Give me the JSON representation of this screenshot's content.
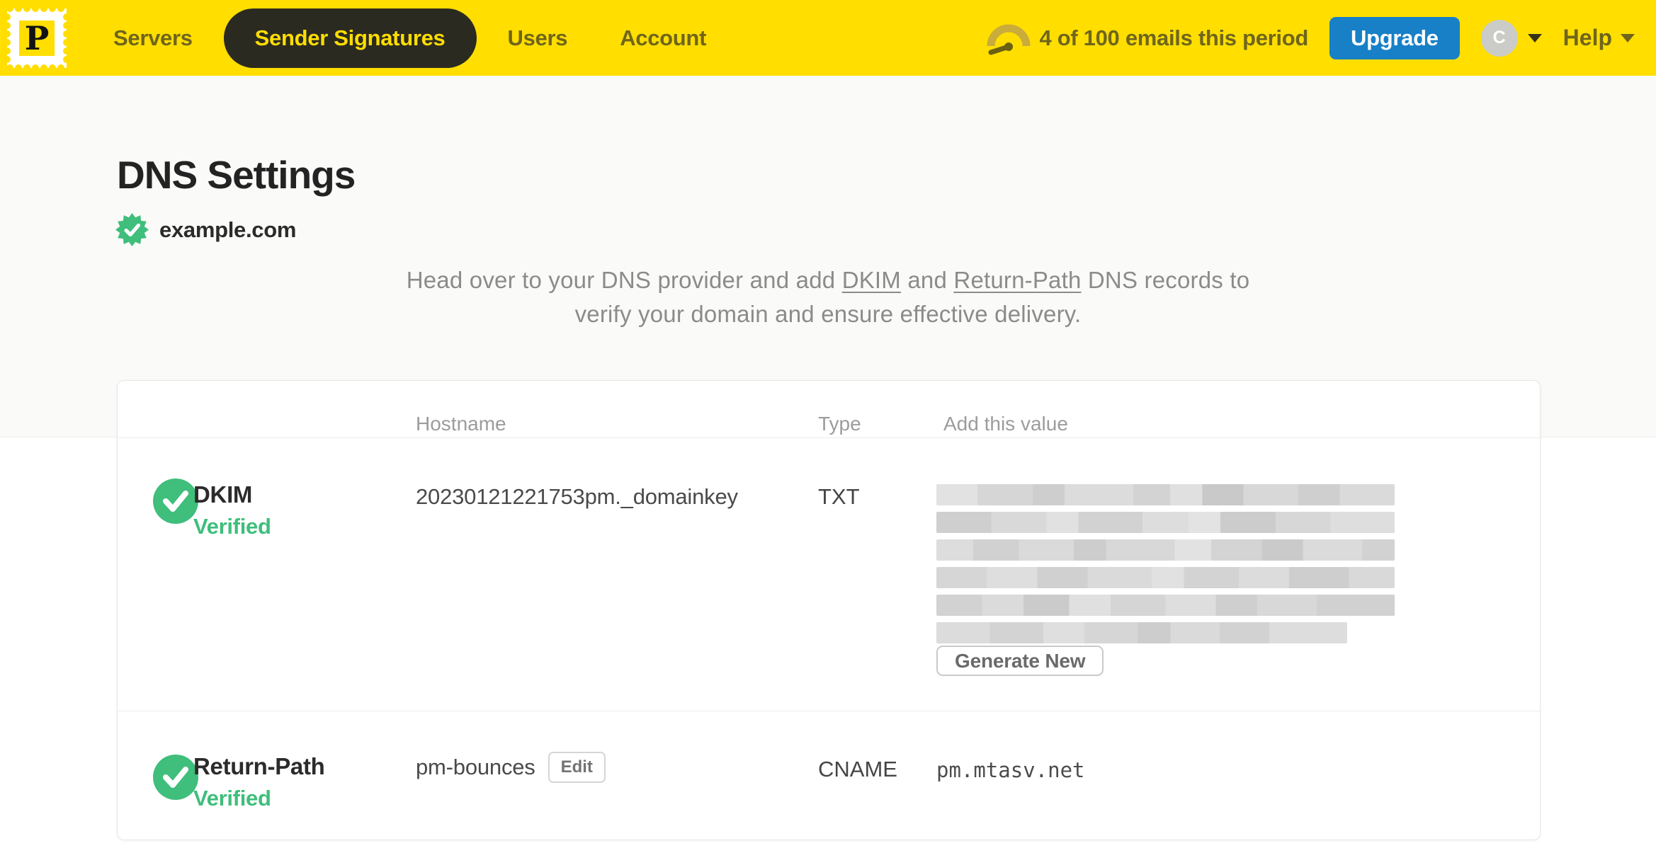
{
  "brand": {
    "logo_letter": "P"
  },
  "nav": {
    "items": [
      {
        "label": "Servers",
        "active": false
      },
      {
        "label": "Sender Signatures",
        "active": true
      },
      {
        "label": "Users",
        "active": false
      },
      {
        "label": "Account",
        "active": false
      }
    ],
    "usage_text": "4 of 100 emails this period",
    "upgrade_label": "Upgrade",
    "avatar_initial": "C",
    "help_label": "Help"
  },
  "page": {
    "title": "DNS Settings",
    "domain": "example.com",
    "intro": {
      "part1": "Head over to your DNS provider and add ",
      "dkim_link": "DKIM",
      "part2": " and ",
      "return_path_link": "Return-Path",
      "part3_line1": " DNS records to",
      "part3_line2": "verify your domain and ensure effective delivery."
    }
  },
  "dns_table": {
    "headers": {
      "hostname": "Hostname",
      "type": "Type",
      "value": "Add this value"
    },
    "dkim_row": {
      "name": "DKIM",
      "status": "Verified",
      "hostname": "20230121221753pm._domainkey",
      "type": "TXT",
      "value_redacted": true,
      "generate_button": "Generate New"
    },
    "return_path_row": {
      "name": "Return-Path",
      "status": "Verified",
      "hostname": "pm-bounces",
      "edit_button": "Edit",
      "type": "CNAME",
      "value": "pm.mtasv.net"
    }
  },
  "colors": {
    "brand_yellow": "#FFDE00",
    "nav_pill_bg": "#2B2A21",
    "nav_text_olive": "#6F651B",
    "upgrade_blue": "#1780C7",
    "verified_green": "#3FBE7C",
    "text_dark": "#232323",
    "text_gray": "#8B8B8B"
  }
}
